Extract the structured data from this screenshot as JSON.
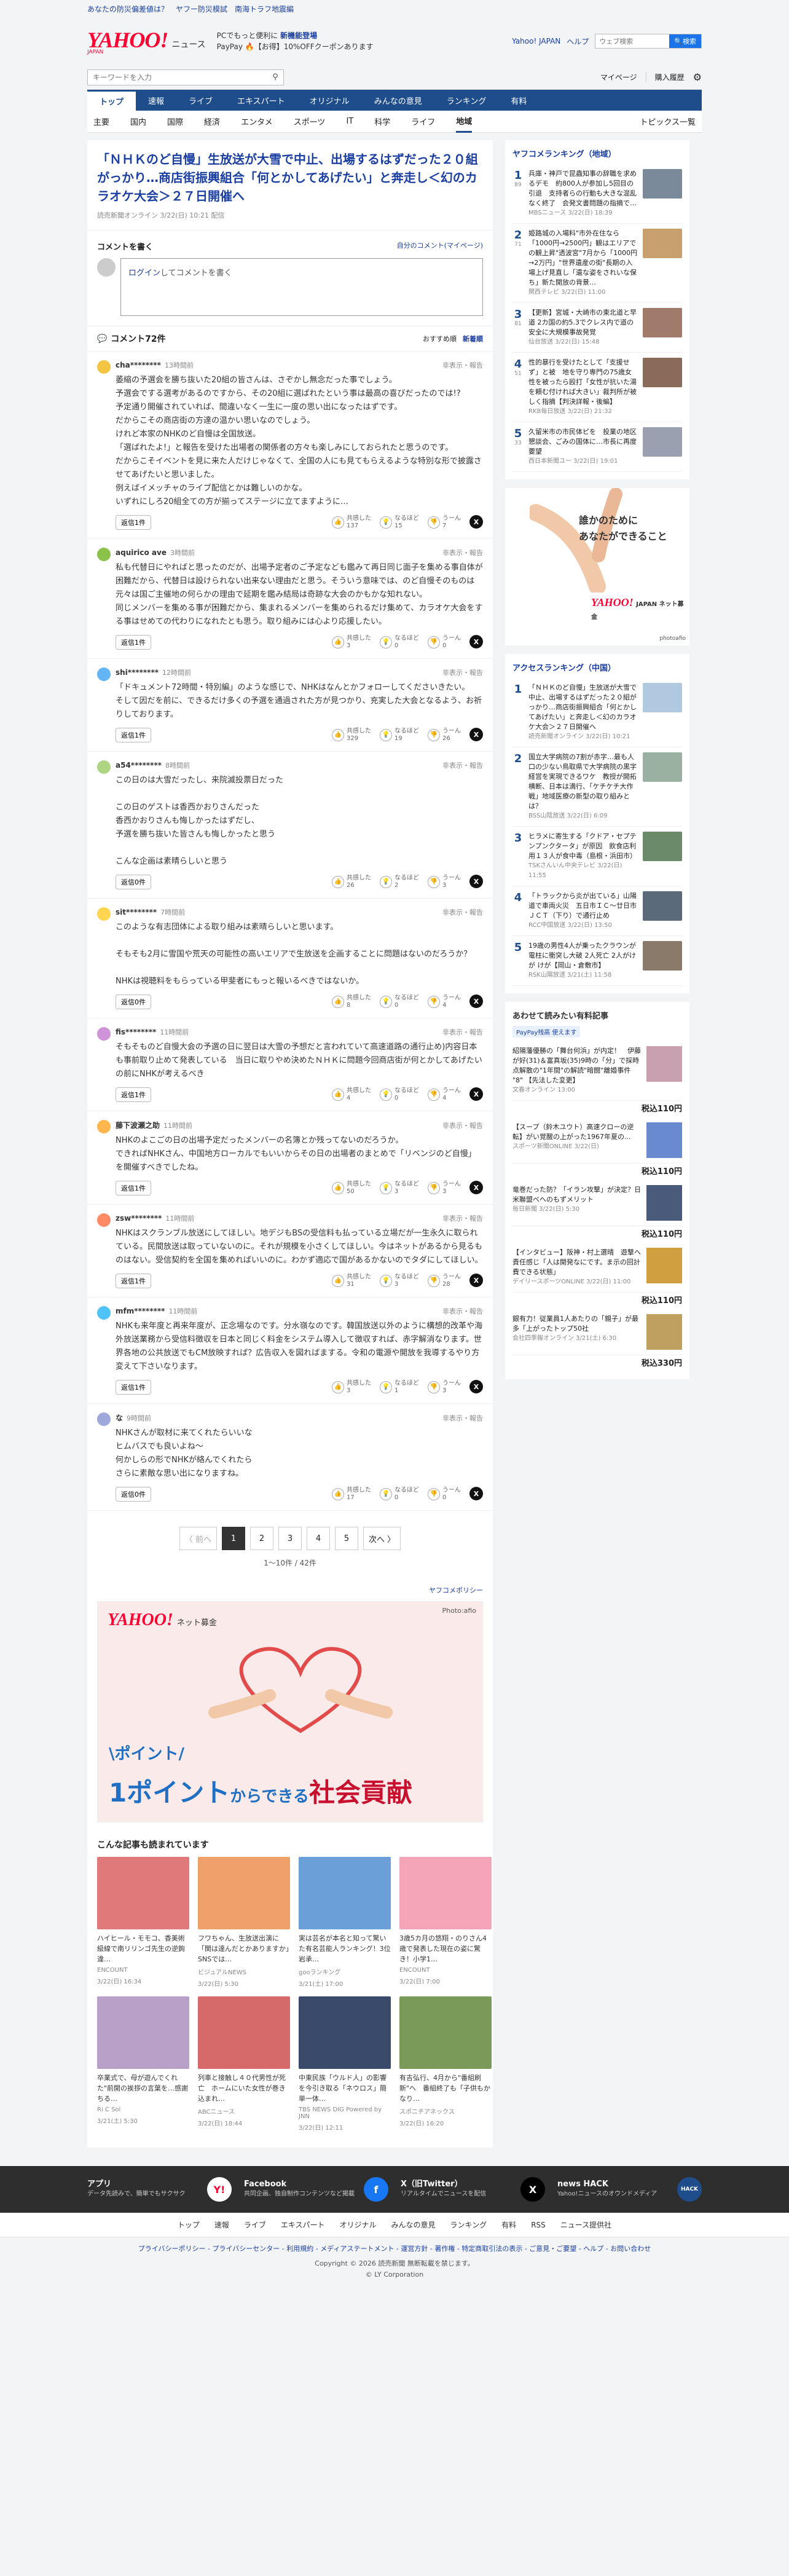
{
  "promo": [
    "あなたの防災偏差値は？",
    "ヤフー防災模試",
    "南海トラフ地震編"
  ],
  "header": {
    "logo_text": "YAHOO!",
    "logo_sub": "JAPAN",
    "site_name": "ニュース",
    "ad_line1_pre": "PCでもっと便利に",
    "ad_line1_link": "新機能登場",
    "ad_line2": "PayPay 🔥【お得】10%OFFクーポンあります",
    "links": [
      "Yahoo! JAPAN",
      "ヘルプ"
    ],
    "search_placeholder": "ウェブ検索",
    "search_button": "🔍検索"
  },
  "searchrow": {
    "placeholder": "キーワードを入力",
    "mypage": "マイページ",
    "history": "購入履歴"
  },
  "nav": [
    "トップ",
    "速報",
    "ライブ",
    "エキスパート",
    "オリジナル",
    "みんなの意見",
    "ランキング",
    "有料"
  ],
  "subnav": [
    "主要",
    "国内",
    "国際",
    "経済",
    "エンタメ",
    "スポーツ",
    "IT",
    "科学",
    "ライフ",
    "地域"
  ],
  "subnav_right": "トピックス一覧",
  "article": {
    "title": "「ＮＨＫのど自慢」生放送が大雪で中止、出場するはずだった２０組がっかり…商店街振興組合「何とかしてあげたい」と奔走し＜幻のカラオケ大会＞２７日開催へ",
    "meta": "読売新聞オンライン 3/22(日) 10:21 配信"
  },
  "comment_box": {
    "title": "コメントを書く",
    "mine": "自分のコメント(マイページ)",
    "login_link": "ログイン",
    "login_rest": "してコメントを書く"
  },
  "comment_list": {
    "title": "コメント72件",
    "sort": [
      "おすすめ順",
      "新着順"
    ]
  },
  "comments": [
    {
      "user": "cha********",
      "time": "13時間前",
      "report": "非表示・報告",
      "text": "萎縮の予選会を勝ち抜いた20組の皆さんは、さぞかし無念だった事でしょう。\n予選会でする選考があるのですから、その20組に選ばれたという事は最高の喜びだったのでは!?\n予定通り開催されていれば、間違いなく一生に一度の思い出になったはずです。\nだからこその商店街の方達の温かい思いなのでしょう。\nけれど本家のNHKのど自慢は全国放送。\n「選ばれたよ!」と報告を受けた出場者の関係者の方々も楽しみにしておられたと思うのです。\nだからこそイベントを見に来た人だけじゃなくて、全国の人にも見てもらえるような特別な形で披露させてあげたいと思いました。\n例えばイメッチャのライブ配信とかは難しいのかな。\nいずれにしろ20組全ての方が揃ってステージに立てますように…",
      "reply": "返信1件",
      "v1": "共感した",
      "v1n": "137",
      "v2": "なるほど",
      "v2n": "15",
      "v3": "うーん",
      "v3n": "7",
      "color": "#f4c542"
    },
    {
      "user": "aquirico ave",
      "time": "3時間前",
      "report": "非表示・報告",
      "text": "私も代替日にやればと思ったのだが、出場予定者のご予定なども鑑みて再日同じ面子を集める事自体が困難だから、代替日は設けられない出来ない理由だと思う。そういう意味では、のど自慢そのものは元々は国ご主催地の何らかの理由で延期を鑑み結局は奇跡な大会のかもかな知れない。\n同じメンバーを集める事が困難だから、集まれるメンバーを集められるだけ集めて、カラオケ大会をする事はせめての代わりになれたとも思う。取り組みには心より応援したい。",
      "reply": "返信1件",
      "v1": "共感した",
      "v1n": "3",
      "v2": "なるほど",
      "v2n": "0",
      "v3": "うーん",
      "v3n": "0",
      "color": "#8bc34a"
    },
    {
      "user": "shi********",
      "time": "12時間前",
      "report": "非表示・報告",
      "text": "「ドキュメント72時間・特別編」のような感じで、NHKはなんとかフォローしてくださいきたい。\nそして因だを前に、できるだけ多くの予選を通過された方が見つかり、充実した大会となるよう、お祈りしております。",
      "reply": "返信1件",
      "v1": "共感した",
      "v1n": "329",
      "v2": "なるほど",
      "v2n": "19",
      "v3": "うーん",
      "v3n": "26",
      "color": "#64b5f6"
    },
    {
      "user": "a54********",
      "time": "8時間前",
      "report": "非表示・報告",
      "text": "この日のは大雪だったし、来院滅投票日だった\n\nこの日のゲストは香西かおりさんだった\n香西かおりさんも悔しかったはずだし、\n予選を勝ち抜いた皆さんも悔しかったと思う\n\nこんな企画は素晴らしいと思う",
      "reply": "返信0件",
      "v1": "共感した",
      "v1n": "26",
      "v2": "なるほど",
      "v2n": "2",
      "v3": "うーん",
      "v3n": "3",
      "color": "#aed581"
    },
    {
      "user": "sit********",
      "time": "7時間前",
      "report": "非表示・報告",
      "text": "このような有志団体による取り組みは素晴らしいと思います。\n\nそもそも2月に雪国や荒天の可能性の高いエリアで生放送を企画することに問題はないのだろうか？\n\nNHKは視聴料をもらっている甲斐者にもっと報いるべきではないか。",
      "reply": "返信0件",
      "v1": "共感した",
      "v1n": "8",
      "v2": "なるほど",
      "v2n": "0",
      "v3": "うーん",
      "v3n": "4",
      "color": "#ffd54f"
    },
    {
      "user": "fis********",
      "time": "11時間前",
      "report": "非表示・報告",
      "text": "そもそものど自慢大会の予選の日に翌日は大雪の予想だと言われていて高速道路の通行止め)内容日本も事前取り止めて発表している　当日に取りやめ決めたＮＨＫに問題今回商店街が何とかしてあげたいの前にNHKが考えるべき",
      "reply": "返信1件",
      "v1": "共感した",
      "v1n": "4",
      "v2": "なるほど",
      "v2n": "0",
      "v3": "うーん",
      "v3n": "4",
      "color": "#ce93d8"
    },
    {
      "user": "藤下波瀬之助",
      "time": "11時間前",
      "report": "非表示・報告",
      "text": "NHKのよこごの日の出場予定だったメンバーの名簿とか残ってないのだろうか。\nできればNHKさん、中国地方ローカルでもいいからその日の出場者のまとめで「リベンジのど自慢」を開催すべきでしたね。",
      "reply": "返信1件",
      "v1": "共感した",
      "v1n": "50",
      "v2": "なるほど",
      "v2n": "3",
      "v3": "うーん",
      "v3n": "3",
      "color": "#ffb74d"
    },
    {
      "user": "zsw********",
      "time": "11時間前",
      "report": "非表示・報告",
      "text": "NHKはスクランブル放送にしてほしい。地デジもBSの受信料も払っている立場だが一生永久に取られている。民間放送は取っていないのに。それが規模を小さくしてほしい。今はネットがあるから見るものはない。受信契約を全国を集めればいいのに。わかず適応で国があるかないのでタダにしてほしい。",
      "reply": "返信1件",
      "v1": "共感した",
      "v1n": "31",
      "v2": "なるほど",
      "v2n": "3",
      "v3": "うーん",
      "v3n": "28",
      "color": "#ff8a65"
    },
    {
      "user": "mfm********",
      "time": "11時間前",
      "report": "非表示・報告",
      "text": "NHKも来年度と再来年度が、正念場なのです。分水嶺なのです。韓国放送以外のように構想的改革や海外放送業務から受信料徴収を日本と同じく料金をシステム導入して徴収すれば、赤字解消なります。世界各地の公共放送でもCM放映すれば？広告収入を図ればまする。令和の電源や開放を我導するやり方変えて下さいなります。",
      "reply": "返信1件",
      "v1": "共感した",
      "v1n": "3",
      "v2": "なるほど",
      "v2n": "1",
      "v3": "うーん",
      "v3n": "3",
      "color": "#4fc3f7"
    },
    {
      "user": "な",
      "time": "9時間前",
      "report": "非表示・報告",
      "text": "NHKさんが取材に来てくれたらいいな\nヒムバスでも良いよね〜\n何かしらの形でNHKが絡んでくれたら\nさらに素敵な思い出になりますね。",
      "reply": "返信0件",
      "v1": "共感した",
      "v1n": "17",
      "v2": "なるほど",
      "v2n": "0",
      "v3": "うーん",
      "v3n": "0",
      "color": "#9fa8da"
    }
  ],
  "pager": {
    "prev": "〈 前へ",
    "pages": [
      "1",
      "2",
      "3",
      "4",
      "5"
    ],
    "next": "次へ 〉",
    "count": "1〜10件 / 42件"
  },
  "policy": "ヤフコメポリシー",
  "banner": {
    "logo": "YAHOO!",
    "sub": "JAPAN",
    "name": "ネット募金",
    "photo": "Photo:afio",
    "line1": "\\ポイント/",
    "line2a": "1ポイント",
    "line2b": "からできる",
    "line2c": "社会貢献"
  },
  "recommend": {
    "title": "こんな記事も読まれています",
    "cards": [
      {
        "title": "ハイヒール・モモコ、香美術級線で南リリンゴ先生の逆鉤違…",
        "src": "ENCOUNT",
        "time": "3/22(日) 16:34",
        "color": "#e07a7a"
      },
      {
        "title": "フワちゃん、生放送出演に「関は達んだとかありますか」SNSでは…",
        "src": "ビジュアルNEWS",
        "time": "3/22(日) 5:30",
        "color": "#f0a06a"
      },
      {
        "title": "実は芸名が本名と知って驚いた有名芸能人ランキング！3位岩承…",
        "src": "gooランキング",
        "time": "3/21(土) 17:00",
        "color": "#6a9fd8"
      },
      {
        "title": "3歳5カ月の悠翔・のりさん4歳で発表した現在の姿に驚き！小学1…",
        "src": "ENCOUNT",
        "time": "3/22(日) 7:00",
        "color": "#f4a6b8"
      },
      {
        "title": "卒業式で、母が遊んでくれた\"前開の挨拶の言葉を…感謝ちる…",
        "src": "Ri C Sol",
        "time": "3/21(土) 5:30",
        "color": "#b8a0c8"
      },
      {
        "title": "列車と接触し４０代男性が死亡　ホームにいた女性が巻き込まれ…",
        "src": "ABCニュース",
        "time": "3/22(日) 18:44",
        "color": "#d66a6a"
      },
      {
        "title": "中東民族「ウルド人」の影響を今引き取る「ネウロス」簡単一体…",
        "src": "TBS NEWS DIG Powered by JNN",
        "time": "3/22(日) 12:11",
        "color": "#3a4a6a"
      },
      {
        "title": "有吉弘行、4月から\"番組刷新\"へ　番組終了も「子供もかなり…",
        "src": "スポニチアネックス",
        "time": "3/22(日) 16:20",
        "color": "#7a9a5a"
      }
    ]
  },
  "side_ranking": {
    "title": "ヤフコメランキング（地域）",
    "items": [
      {
        "n": "1",
        "cm": "89",
        "title": "兵庫・神戸で昆蟲知事の辞職を求めるデモ　約800人が参加し5回目の引退　支持者らの行動も大きな混乱なく終了　会発文書問題の指摘で…",
        "src": "MBSニュース 3/22(日) 18:39",
        "color": "#7a8a9a"
      },
      {
        "n": "2",
        "cm": "71",
        "title": "姫路城の入場料\"市外在住なら「1000円→2500円」観はエリアでの観上昇\"透波宮\"7月から「1000円→2万円」\"世界遺産の街\"長期の入場上げ見直し「遺な姿をされいな保ち」新た開放の背景…",
        "src": "関西テレビ 3/22(日) 11:00",
        "color": "#c8a070"
      },
      {
        "n": "3",
        "cm": "81",
        "title": "【更新】宮城・大崎市の東北道と早道 2カ国の約5.3でクレス内で道の安全に大規模事故発覚",
        "src": "仙台放送 3/22(日) 15:48",
        "color": "#a07a6a"
      },
      {
        "n": "4",
        "cm": "51",
        "title": "性的暴行を受けたとして「支援せず」と被　地を守り専門の75歳女性を被ったら殴打「女性が抗いた湯を頼む付ければ大きい」裁判所が被しく指摘【判決詳報・後編】",
        "src": "RKB毎日放送 3/22(日) 21:32",
        "color": "#8a6a5a"
      },
      {
        "n": "5",
        "cm": "33",
        "title": "久留米市の市民体ピを　投業の地区懇談会、ごみの国体に…市長に再度要望",
        "src": "西日本新聞ユー 3/22(日) 19:01",
        "color": "#9aa0b0"
      }
    ]
  },
  "side_ad": {
    "msg1": "誰かのために",
    "msg2": "あなたができること",
    "logo": "YAHOO!",
    "sub": "JAPAN ネット募金",
    "photo": "photoafio"
  },
  "side_access": {
    "title": "アクセスランキング（中国）",
    "items": [
      {
        "n": "1",
        "title": "「ＮＨＫのど自慢」生放送が大雪で中止、出場するはずだった２０組がっかり…商店街振興組合「何とかしてあげたい」と奔走し＜幻のカラオケ大会＞２７日開催へ",
        "src": "読売新聞オンライン 3/22(日) 10:21",
        "color": "#b0c8e0"
      },
      {
        "n": "2",
        "title": "国立大学病院の7割が赤字…最も人口の少ない鳥取県で大学病院の黒字経営を実現できるワケ　教授が開拓横断、日本は満行、「ケチケチ大作戦」地域医療の新型の取り組みとは？",
        "src": "BSS山陰放送 3/22(日) 6:09",
        "color": "#9ab0a0"
      },
      {
        "n": "3",
        "title": "ヒラメに寄生する「クドア・セプテンプンクタータ」が原因　飲食店利用１３人が食中毒（島根・浜田市）",
        "src": "TSKさんいん中央テレビ 3/22(日) 11:55",
        "color": "#6a8a6a"
      },
      {
        "n": "4",
        "title": "「トラックから炎が出ている」山陽道で車両火災　五日市ＩＣ〜廿日市ＪＣＴ（下り）で通行止め",
        "src": "RCC中国放送 3/22(日) 13:50",
        "color": "#5a6a7a"
      },
      {
        "n": "5",
        "title": "19歳の男性4人が乗ったクラウンが電柱に衝突し大破 2人死亡 2人がけが けが【岡山・倉敷市】",
        "src": "RSK山陽放送 3/21(土) 11:58",
        "color": "#8a7a6a"
      }
    ]
  },
  "side_paid": {
    "title": "あわせて読みたい有料記事",
    "pp": "PayPay残高 使えます",
    "items": [
      {
        "title": "紹陽藩優勝の「舞台何浜」が内定！　伊藤が好(31)＆富真坂(35)9時の「分」で採時点解散の\"1年間\"の解読\"暗闘\"離婚事件 \"8\" 【先法した変更】",
        "src": "文春オンライン 13:00",
        "price": "税込110円",
        "color": "#c8a0b0"
      },
      {
        "title": "【スープ（鈴木ユウト）高速クローの逆転】がい覚醒の上がった1967年夏の...",
        "src": "スポーツ新聞ONLINE 3/22(日)",
        "price": "税込110円",
        "color": "#6a8ad0"
      },
      {
        "title": "竜巻だった防？「イラン攻撃」が決定？日米聯盟べへのもずメリット",
        "src": "毎日新聞 3/22(日) 5:30",
        "price": "税込110円",
        "color": "#4a5a7a"
      },
      {
        "title": "【インタビュー】阪神・村上選晴　遊撃へ責任感じ「人は開発なにです。ま示の回計費できる状態」",
        "src": "デイリースポーツONLINE 3/22(日) 11:00",
        "price": "税込110円",
        "color": "#d0a040"
      },
      {
        "title": "銀有力！従業員1人あたりの「親子」が最多「上がったトップ50社",
        "src": "会社四季報オンライン 3/21(土) 6:30",
        "price": "税込330円",
        "color": "#c0a060"
      }
    ]
  },
  "footer": {
    "apps": [
      {
        "name": "アプリ",
        "desc": "データ先読みで、簡単でもサクサク",
        "icon": "Y!",
        "bg": "#fff",
        "fg": "#ff0033"
      },
      {
        "name": "Facebook",
        "desc": "共同企画、独自制作コンテンツなど掲載",
        "icon": "f",
        "bg": "#1877f2",
        "fg": "#fff"
      },
      {
        "name": "X（旧Twitter）",
        "desc": "リアルタイムでニュースを配信",
        "icon": "X",
        "bg": "#000",
        "fg": "#fff"
      },
      {
        "name": "news HACK",
        "desc": "Yahoo!ニュースのオウンドメディア",
        "icon": "HACK",
        "bg": "#1f4d8c",
        "fg": "#fff"
      }
    ],
    "nav": [
      "トップ",
      "速報",
      "ライブ",
      "エキスパート",
      "オリジナル",
      "みんなの意見",
      "ランキング",
      "有料",
      "RSS",
      "ニュース提供社"
    ],
    "links": "プライバシーポリシー - プライバシーセンター - 利用規約 - メディアステートメント - 運営方針 - 著作権 - 特定商取引法の表示 - ご意見・ご要望 - ヘルプ - お問い合わせ",
    "copy1": "Copyright © 2026 読売新聞 無断転載を禁じます。",
    "copy2": "© LY Corporation"
  }
}
